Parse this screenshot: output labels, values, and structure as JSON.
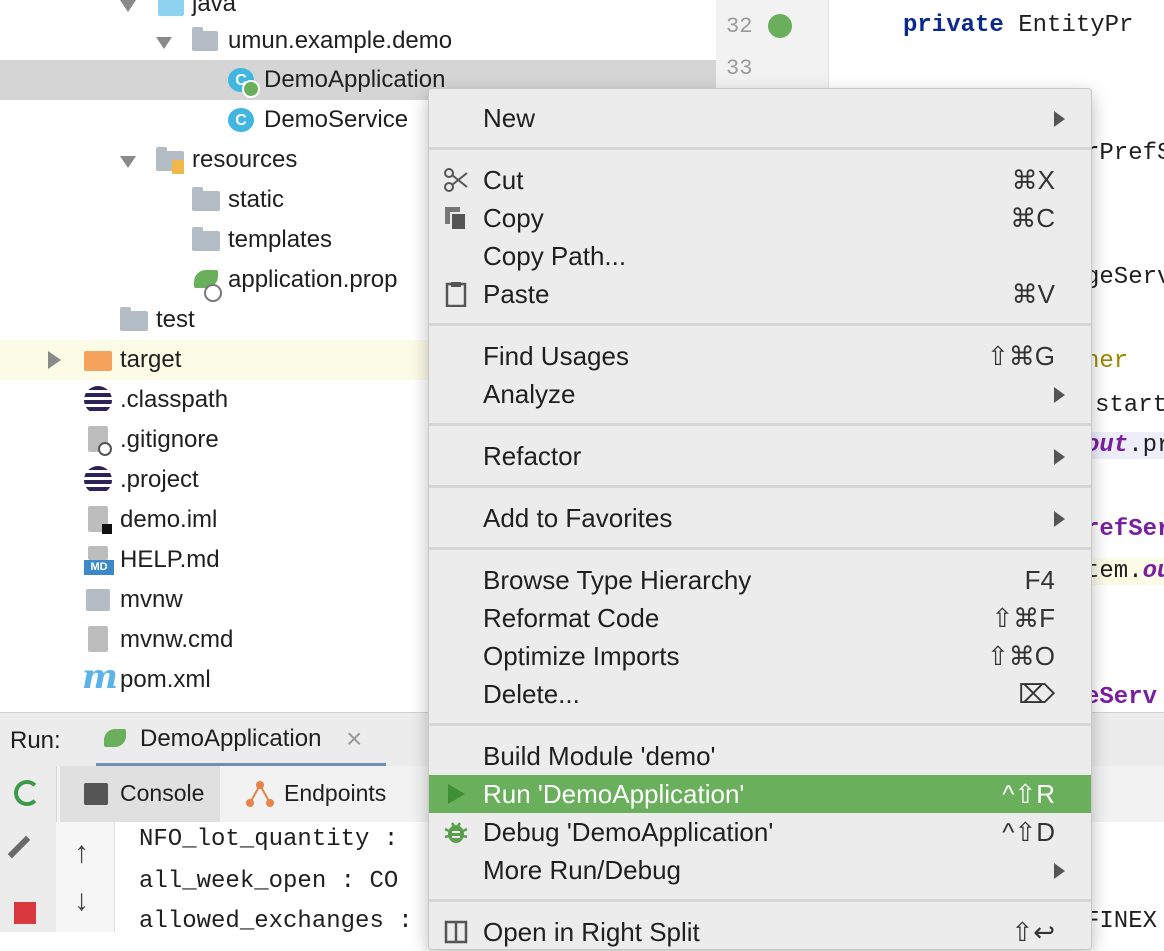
{
  "tree": {
    "items": [
      {
        "label": "java"
      },
      {
        "label": "umun.example.demo"
      },
      {
        "label": "DemoApplication"
      },
      {
        "label": "DemoService"
      },
      {
        "label": "resources"
      },
      {
        "label": "static"
      },
      {
        "label": "templates"
      },
      {
        "label": "application.prop"
      },
      {
        "label": "test"
      },
      {
        "label": "target"
      },
      {
        "label": ".classpath"
      },
      {
        "label": ".gitignore"
      },
      {
        "label": ".project"
      },
      {
        "label": "demo.iml"
      },
      {
        "label": "HELP.md"
      },
      {
        "label": "mvnw"
      },
      {
        "label": "mvnw.cmd"
      },
      {
        "label": "pom.xml"
      }
    ],
    "md_badge": "MD",
    "class_badge": "C",
    "maven_badge": "m"
  },
  "gutter": {
    "line_numbers": [
      "32",
      "33"
    ]
  },
  "editor": {
    "line1_keyword": "private",
    "line1_rest": " EntityPr",
    "fragments": [
      "rPrefS",
      "geServ",
      "her",
      "start",
      "out",
      ".pr",
      "refSer",
      "tem.",
      "ou",
      "eServ",
      "FINEX"
    ]
  },
  "run": {
    "label": "Run:",
    "config_tab": "DemoApplication",
    "close_glyph": "×",
    "tabs": [
      {
        "label": "Console"
      },
      {
        "label": "Endpoints"
      }
    ],
    "console_lines": [
      "NFO_lot_quantity :",
      "all_week_open : CO",
      "allowed_exchanges :"
    ]
  },
  "context_menu": {
    "items": [
      {
        "label": "New",
        "shortcut": "",
        "submenu": true
      },
      {
        "label": "Cut",
        "shortcut": "⌘X",
        "icon": "scissors-icon"
      },
      {
        "label": "Copy",
        "shortcut": "⌘C",
        "icon": "copy-icon"
      },
      {
        "label": "Copy Path...",
        "shortcut": ""
      },
      {
        "label": "Paste",
        "shortcut": "⌘V",
        "icon": "clipboard-icon"
      },
      {
        "label": "Find Usages",
        "shortcut": "⇧⌘G"
      },
      {
        "label": "Analyze",
        "shortcut": "",
        "submenu": true
      },
      {
        "label": "Refactor",
        "shortcut": "",
        "submenu": true
      },
      {
        "label": "Add to Favorites",
        "shortcut": "",
        "submenu": true
      },
      {
        "label": "Browse Type Hierarchy",
        "shortcut": "F4"
      },
      {
        "label": "Reformat Code",
        "shortcut": "⇧⌘F"
      },
      {
        "label": "Optimize Imports",
        "shortcut": "⇧⌘O"
      },
      {
        "label": "Delete...",
        "shortcut": "⌦"
      },
      {
        "label": "Build Module 'demo'",
        "shortcut": ""
      },
      {
        "label": "Run 'DemoApplication'",
        "shortcut": "^⇧R",
        "icon": "run-icon",
        "selected": true
      },
      {
        "label": "Debug 'DemoApplication'",
        "shortcut": "^⇧D",
        "icon": "bug-icon"
      },
      {
        "label": "More Run/Debug",
        "shortcut": "",
        "submenu": true
      },
      {
        "label": "Open in Right Split",
        "shortcut": "⇧↩",
        "icon": "split-icon"
      }
    ]
  },
  "colors": {
    "selection": "#6aaf5b",
    "tree_selected_row": "#d5d5d5",
    "tree_excluded_row": "#fbfbe6",
    "keyword": "#0b2a8a",
    "purple": "#7a1fa2"
  }
}
